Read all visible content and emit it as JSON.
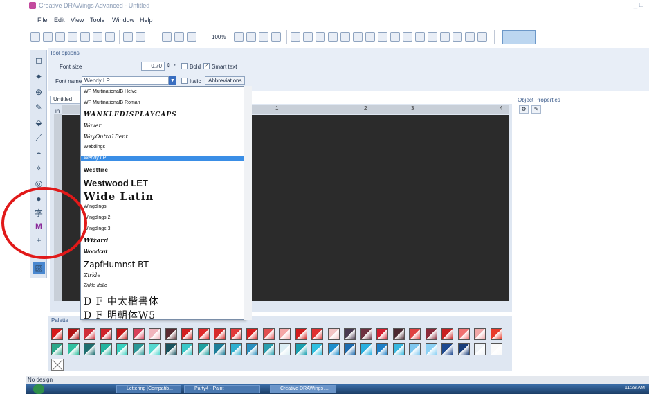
{
  "window": {
    "title": "Creative DRAWings Advanced - Untitled",
    "controls": "_ □"
  },
  "menu": [
    "File",
    "Edit",
    "View",
    "Tools",
    "Window",
    "Help"
  ],
  "toolbar": {
    "zoom": "100%"
  },
  "tool_options": {
    "header": "Tool options",
    "font_size_label": "Font size",
    "font_size_value": "0.70",
    "font_size_unit": "\"",
    "bold_label": "Bold",
    "smart_text_label": "Smart text",
    "font_name_label": "Font name",
    "font_name_value": "Wendy LP",
    "italic_label": "Italic",
    "abbreviations_label": "Abbreviations"
  },
  "font_list": [
    {
      "label": "WP MultinationalB Helve",
      "selected": false
    },
    {
      "label": "WP MultinationalB Roman",
      "selected": false
    },
    {
      "label": "WANKLEDISPLAYCAPS",
      "selected": false
    },
    {
      "label": "Waver",
      "selected": false
    },
    {
      "label": "WayOutta1Bent",
      "selected": false
    },
    {
      "label": "Webdings",
      "selected": false
    },
    {
      "label": "Wendy LP",
      "selected": true
    },
    {
      "label": "Westfire",
      "selected": false
    },
    {
      "label": "Westwood LET",
      "selected": false
    },
    {
      "label": "Wide Latin",
      "selected": false
    },
    {
      "label": "Wingdings",
      "selected": false
    },
    {
      "label": "Wingdings 2",
      "selected": false
    },
    {
      "label": "Wingdings 3",
      "selected": false
    },
    {
      "label": "Wizard",
      "selected": false
    },
    {
      "label": "Woodcut",
      "selected": false
    },
    {
      "label": "ZapfHumnst BT",
      "selected": false
    },
    {
      "label": "Zirkle",
      "selected": false
    },
    {
      "label": "Zirkle Italic",
      "selected": false
    },
    {
      "label": "D F 中太楷書体",
      "selected": false
    },
    {
      "label": "D F 明朝体W5",
      "selected": false
    }
  ],
  "document": {
    "tab": "Untitled",
    "ruler_unit": "in",
    "ruler_numbers": [
      "1",
      "2",
      "3",
      "4"
    ]
  },
  "object_properties": {
    "header": "Object Properties"
  },
  "palette": {
    "header": "Palette",
    "row1": [
      "#d81a1a",
      "#b01414",
      "#cf2f3a",
      "#d1242a",
      "#c41717",
      "#d8405a",
      "#f0b4bc",
      "#5a2b32",
      "#d42020",
      "#e02828",
      "#d62c2c",
      "#e33a3a",
      "#d81e1e",
      "#e15050",
      "#f5a6a6",
      "#d21c1c",
      "#e03030",
      "#f2c4c4",
      "#4a3a50",
      "#6e3040",
      "#d42030",
      "#4b2830",
      "#e04040",
      "#8a2a3a",
      "#c82020",
      "#f07070",
      "#f0a8a8",
      "#e83a2a"
    ],
    "row2": [
      "#2aa88a",
      "#30c0a0",
      "#1e6e70",
      "#24b4a0",
      "#38d0c0",
      "#2a9898",
      "#54d8d0",
      "#1a5460",
      "#3ac8c8",
      "#20a0a0",
      "#1e7e9a",
      "#30b0d0",
      "#2a90c0",
      "#2aa0b0",
      "#dceef4",
      "#1aa0b0",
      "#30c0e0",
      "#1e8ecc",
      "#1e6cb0",
      "#2ab0e0",
      "#1e80c8",
      "#38b8e0",
      "#80c8f0",
      "#8ad0f4",
      "#1e4a90",
      "#1a3e7a",
      "#f0f4f8",
      "#fafafa"
    ]
  },
  "status": "No design",
  "taskbar": {
    "items": [
      "Lettering [Compatib...",
      "Party4 - Paint",
      "Creative DRAWings ..."
    ],
    "clock": "11:28 AM"
  },
  "annotation_color": "#e11919"
}
